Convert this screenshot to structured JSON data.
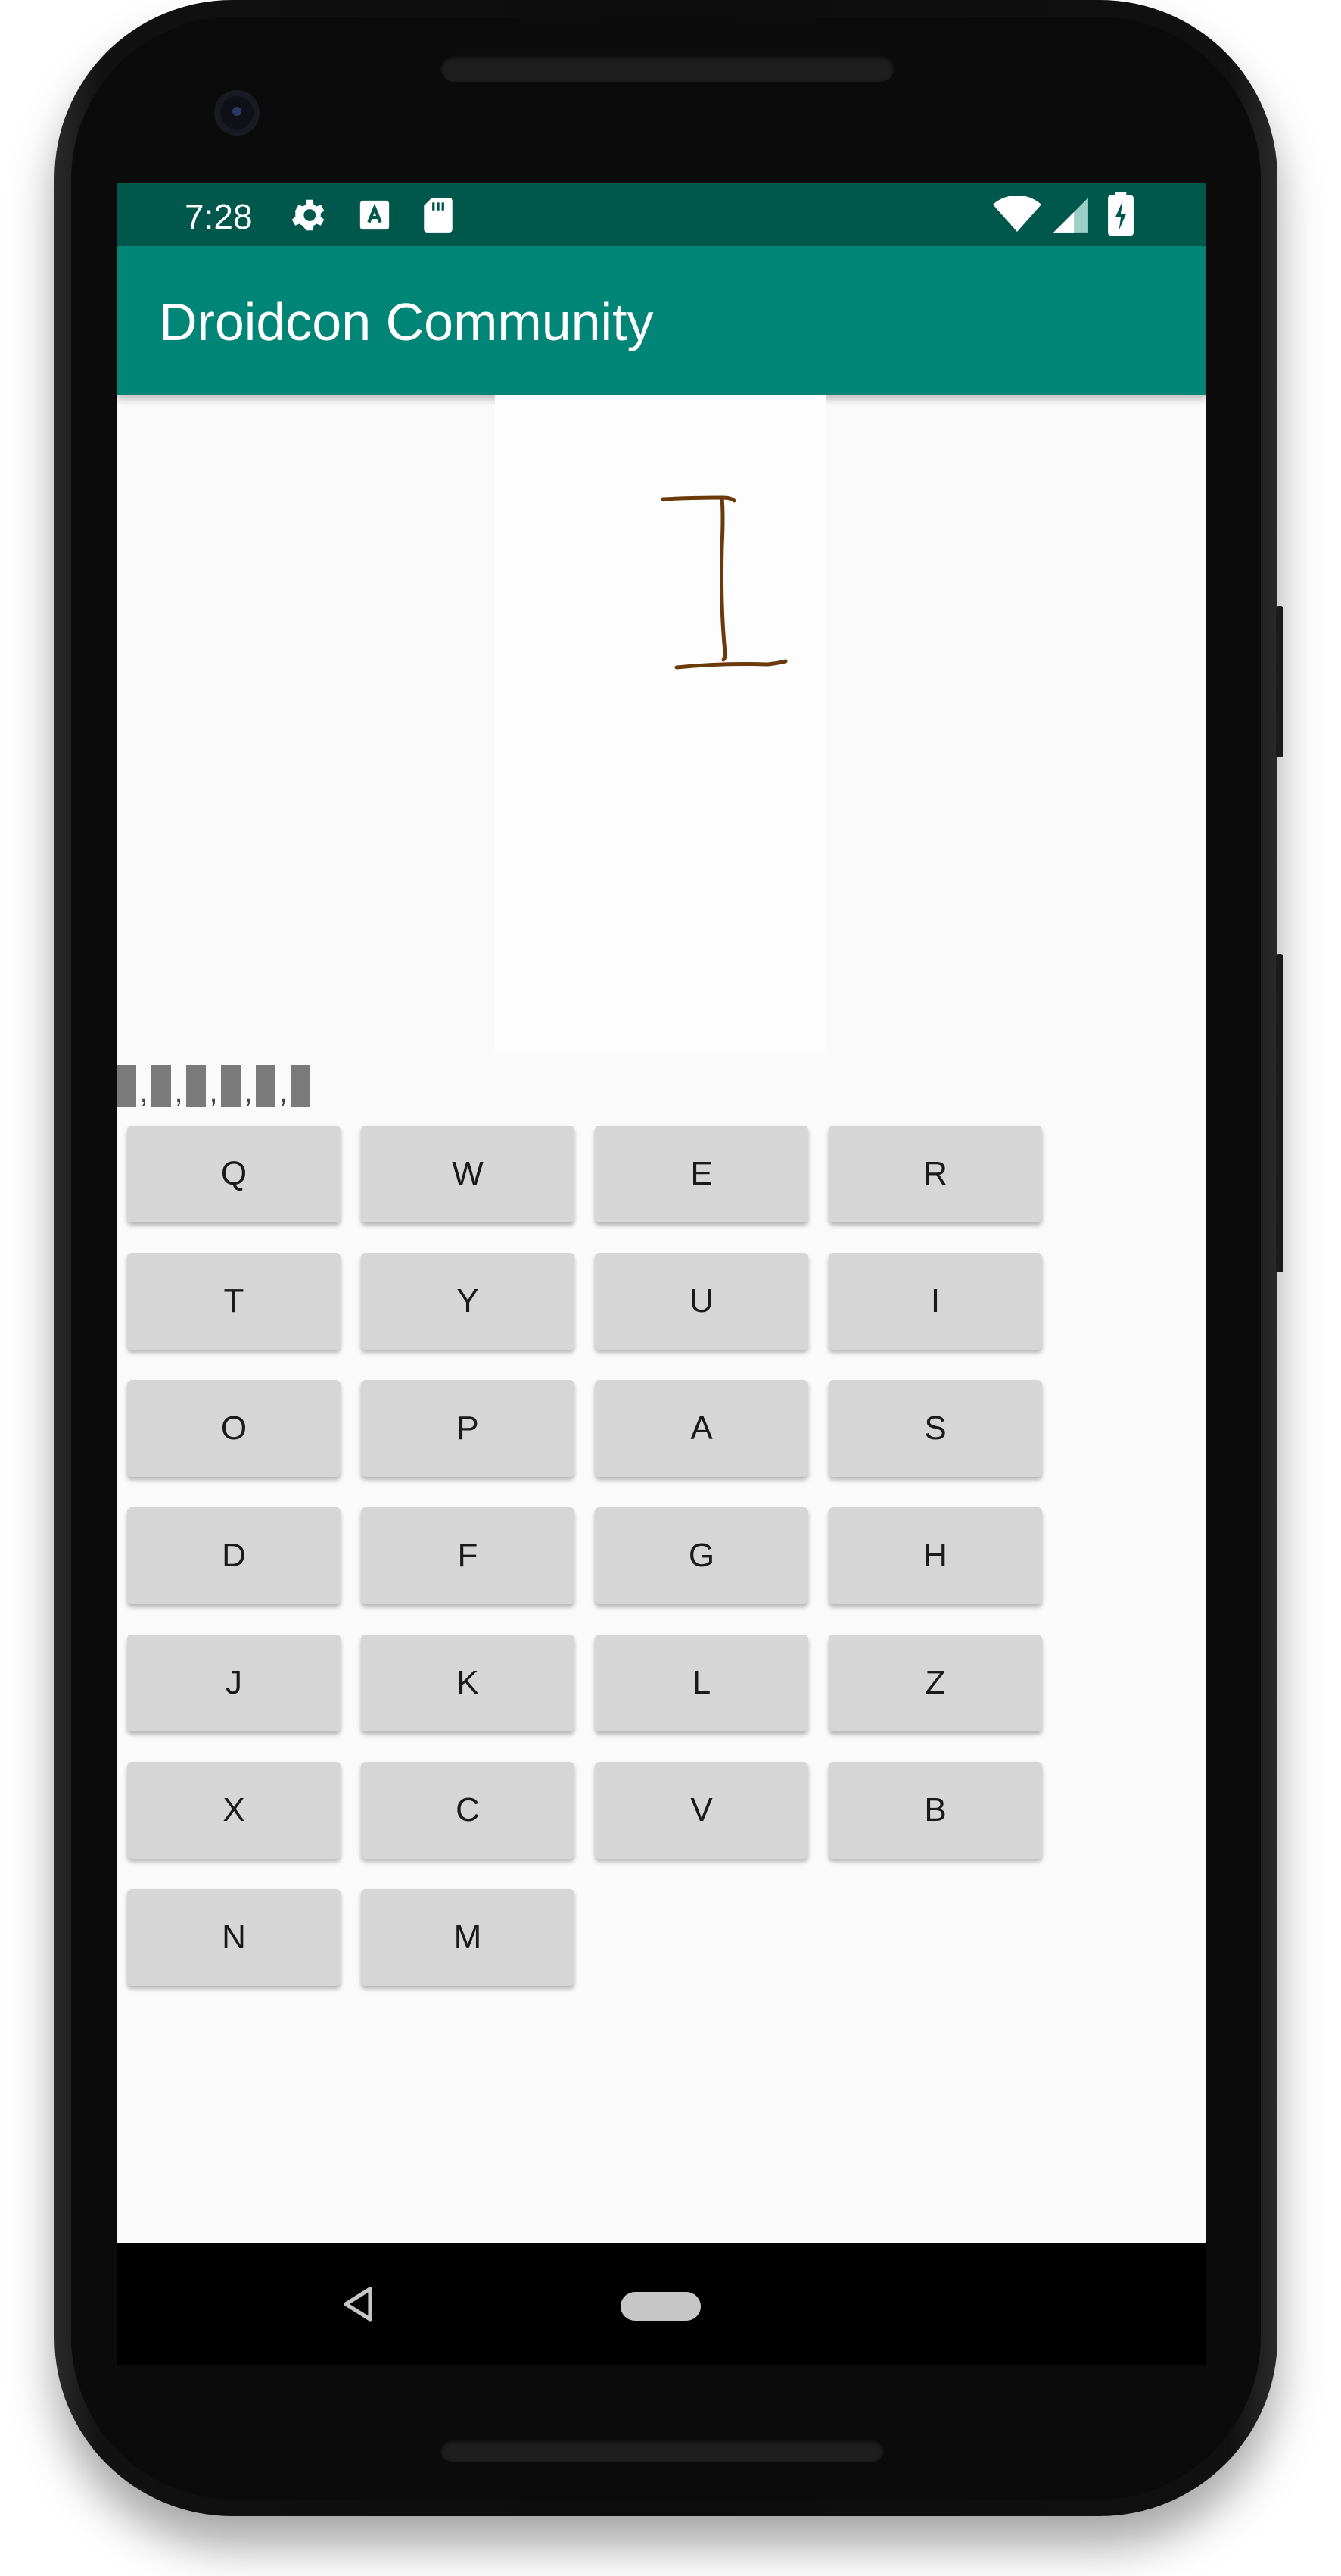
{
  "status_bar": {
    "time": "7:28",
    "left_icons": [
      "gear-icon",
      "font-a-icon",
      "sd-card-icon"
    ],
    "right_icons": [
      "wifi-icon",
      "signal-icon",
      "battery-charging-icon"
    ]
  },
  "app_bar": {
    "title": "Droidcon Community"
  },
  "drawing_canvas": {
    "drawn_glyph": "I"
  },
  "answer_slots": {
    "count": 6,
    "separator": ","
  },
  "keyboard": {
    "keys": [
      "Q",
      "W",
      "E",
      "R",
      "T",
      "Y",
      "U",
      "I",
      "O",
      "P",
      "A",
      "S",
      "D",
      "F",
      "G",
      "H",
      "J",
      "K",
      "L",
      "Z",
      "X",
      "C",
      "V",
      "B",
      "N",
      "M"
    ]
  },
  "nav_bar": {
    "icons": [
      "back-icon",
      "home-icon"
    ]
  },
  "colors": {
    "status_bar": "#00574b",
    "app_bar": "#008577",
    "key_background": "#d6d6d6",
    "stroke": "#6b3a0a"
  }
}
